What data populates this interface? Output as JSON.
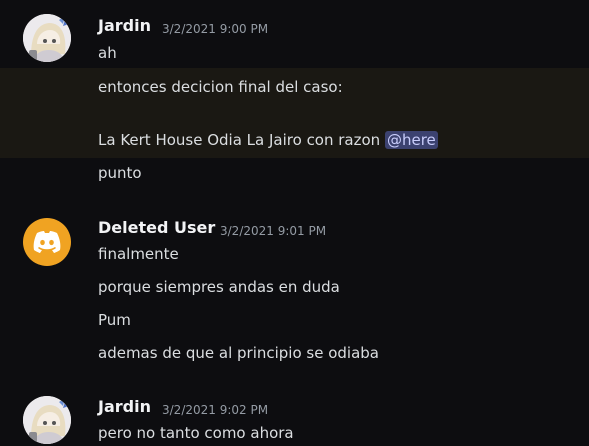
{
  "messages": [
    {
      "author": "Jardin",
      "timestamp": "3/2/2021 9:00 PM",
      "lines": [
        "ah",
        "entonces decicion final del caso:",
        "La Kert House Odia La Jairo con razon",
        "punto"
      ],
      "mention": "@here"
    },
    {
      "author": "Deleted User",
      "timestamp": "3/2/2021 9:01 PM",
      "lines": [
        "finalmente",
        "porque siempres andas en duda",
        "Pum",
        "ademas de que al principio se odiaba"
      ]
    },
    {
      "author": "Jardin",
      "timestamp": "3/2/2021 9:02 PM",
      "lines": [
        "pero no tanto como ahora"
      ]
    }
  ],
  "colors": {
    "background": "#0d0d10",
    "highlight": "#1a1813",
    "mention_bg": "#3c4270",
    "deleted_avatar": "#f0a322"
  },
  "icons": {
    "deleted_user_avatar": "discord-logo-icon",
    "jardin_avatar": "anime-avatar-icon"
  }
}
